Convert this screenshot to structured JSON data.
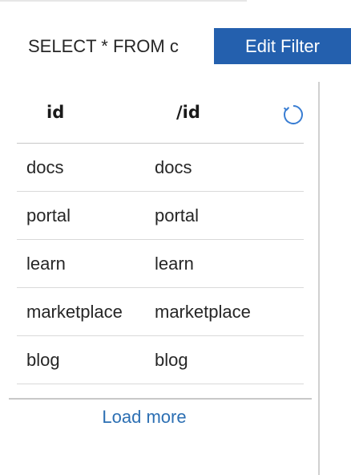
{
  "query": {
    "text": "SELECT * FROM c"
  },
  "toolbar": {
    "edit_filter_label": "Edit Filter"
  },
  "table": {
    "columns": [
      "id",
      "/id"
    ],
    "rows": [
      [
        "docs",
        "docs"
      ],
      [
        "portal",
        "portal"
      ],
      [
        "learn",
        "learn"
      ],
      [
        "marketplace",
        "marketplace"
      ],
      [
        "blog",
        "blog"
      ]
    ],
    "refresh_icon": "refresh-icon"
  },
  "footer": {
    "load_more_label": "Load more"
  },
  "colors": {
    "primary_button": "#2460ae",
    "link": "#2c6fb3",
    "refresh_icon": "#3a7ed3"
  }
}
